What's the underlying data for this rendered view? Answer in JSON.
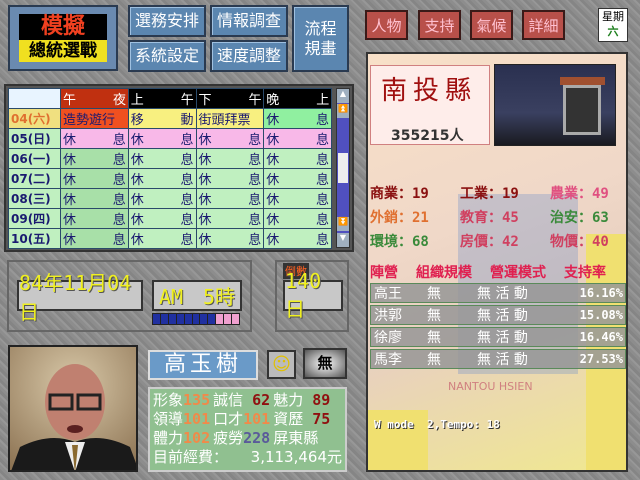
{
  "logo": {
    "line1": "模擬",
    "line2": "總統選戰"
  },
  "menu": {
    "campaign": "選務安排",
    "intel": "情報調查",
    "system": "系統設定",
    "speed": "速度調整",
    "flow": "流程規畫"
  },
  "schedule": {
    "headers": [
      "午　夜",
      "上　午",
      "下　午",
      "晚　上"
    ],
    "rows": [
      {
        "date": "04(六)",
        "cells": [
          [
            "造勢遊行",
            ""
          ],
          [
            "移",
            "動"
          ],
          [
            "街頭拜票",
            ""
          ],
          [
            "休",
            "息"
          ]
        ]
      },
      {
        "date": "05(日)",
        "cells": [
          [
            "休",
            "息"
          ],
          [
            "休",
            "息"
          ],
          [
            "休",
            "息"
          ],
          [
            "休",
            "息"
          ]
        ]
      },
      {
        "date": "06(一)",
        "cells": [
          [
            "休",
            "息"
          ],
          [
            "休",
            "息"
          ],
          [
            "休",
            "息"
          ],
          [
            "休",
            "息"
          ]
        ]
      },
      {
        "date": "07(二)",
        "cells": [
          [
            "休",
            "息"
          ],
          [
            "休",
            "息"
          ],
          [
            "休",
            "息"
          ],
          [
            "休",
            "息"
          ]
        ]
      },
      {
        "date": "08(三)",
        "cells": [
          [
            "休",
            "息"
          ],
          [
            "休",
            "息"
          ],
          [
            "休",
            "息"
          ],
          [
            "休",
            "息"
          ]
        ]
      },
      {
        "date": "09(四)",
        "cells": [
          [
            "休",
            "息"
          ],
          [
            "休",
            "息"
          ],
          [
            "休",
            "息"
          ],
          [
            "休",
            "息"
          ]
        ]
      },
      {
        "date": "10(五)",
        "cells": [
          [
            "休",
            "息"
          ],
          [
            "休",
            "息"
          ],
          [
            "休",
            "息"
          ],
          [
            "休",
            "息"
          ]
        ]
      }
    ]
  },
  "clock": {
    "date": "84年11月04日",
    "time": "AM　5時",
    "countdown_label": "倒數",
    "countdown": "140日",
    "progress_filled": 8,
    "progress_total": 11
  },
  "candidate": {
    "name": "高玉樹",
    "mood_badge": "無",
    "stats": [
      [
        [
          "形象",
          "135",
          "o"
        ],
        [
          "誠信",
          " 62",
          "r"
        ],
        [
          "魅力",
          " 89",
          "r"
        ]
      ],
      [
        [
          "領導",
          "101",
          "o"
        ],
        [
          "口才",
          "101",
          "o"
        ],
        [
          "資歷",
          " 75",
          "r"
        ]
      ],
      [
        [
          "體力",
          "102",
          "o"
        ],
        [
          "疲勞",
          "228",
          "b"
        ],
        [
          "屏東縣",
          "",
          ""
        ]
      ]
    ],
    "funds_label": "目前經費：",
    "funds": "3,113,464元"
  },
  "tabs": {
    "people": "人物",
    "support": "支持",
    "weather": "氣候",
    "detail": "詳細"
  },
  "weekday": {
    "label": "星期",
    "value": "六"
  },
  "county": {
    "name": "南投縣",
    "population": "355215人",
    "stats": [
      {
        "label": "商業：",
        "value": "19",
        "color": "#8a1010"
      },
      {
        "label": "工業：",
        "value": "19",
        "color": "#8a1010"
      },
      {
        "label": "農業：",
        "value": "49",
        "color": "#e05080"
      },
      {
        "label": "外銷：",
        "value": "21",
        "color": "#e07030"
      },
      {
        "label": "教育：",
        "value": "45",
        "color": "#d04060"
      },
      {
        "label": "治安：",
        "value": "63",
        "color": "#3a8a3a"
      },
      {
        "label": "環境：",
        "value": "68",
        "color": "#3a8a3a"
      },
      {
        "label": "房價：",
        "value": "42",
        "color": "#d04060"
      },
      {
        "label": "物價：",
        "value": "40",
        "color": "#d04060"
      }
    ],
    "table_headers": [
      "陣營",
      "組織規模",
      "營運模式",
      "支持率"
    ],
    "camps": [
      {
        "camp": "高王",
        "org": "無",
        "mode": "無 活 動",
        "rate": "16.16%"
      },
      {
        "camp": "洪郭",
        "org": "無",
        "mode": "無 活 動",
        "rate": "15.08%"
      },
      {
        "camp": "徐廖",
        "org": "無",
        "mode": "無 活 動",
        "rate": "16.46%"
      },
      {
        "camp": "馬李",
        "org": "無",
        "mode": "無 活 動",
        "rate": "27.53%"
      }
    ],
    "map_label": "NANTOU HSIEN",
    "debug": "W mode  2,Tempo: 18"
  },
  "colors": {
    "button_blue": "#5b86b0",
    "tab_red": "#b8504a",
    "grid_green": "#c0f0c0"
  }
}
